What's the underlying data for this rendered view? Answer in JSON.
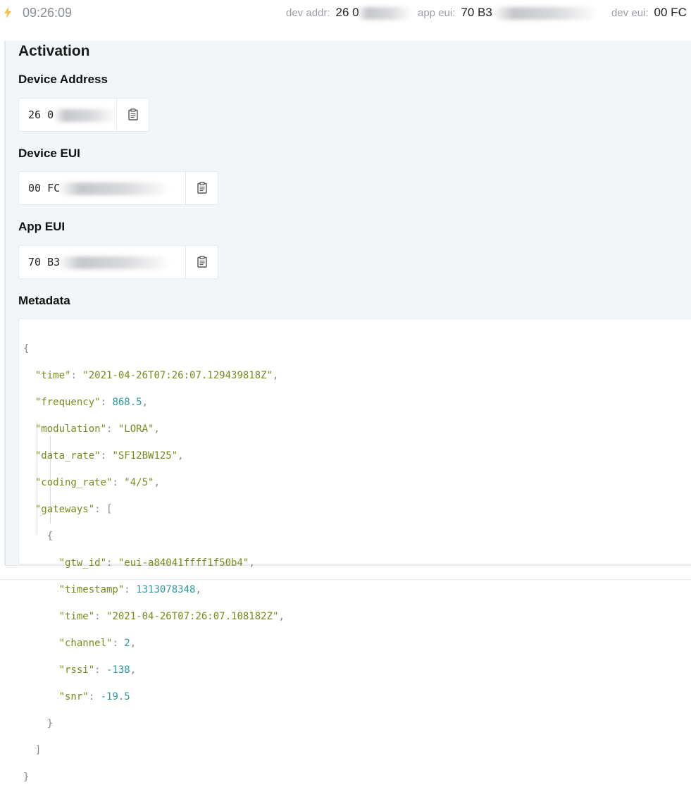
{
  "header": {
    "time": "09:26:09",
    "dev_addr_label": "dev addr:",
    "dev_addr_value": "26 0",
    "app_eui_label": "app eui:",
    "app_eui_value": "70 B3",
    "dev_eui_label": "dev eui:",
    "dev_eui_value": "00 FC"
  },
  "activation": {
    "title": "Activation",
    "device_address_label": "Device Address",
    "device_address_value": "26 0",
    "device_eui_label": "Device EUI",
    "device_eui_value": "00 FC",
    "app_eui_label": "App EUI",
    "app_eui_value": "70 B3"
  },
  "metadata": {
    "label": "Metadata",
    "json": {
      "time_key": "\"time\"",
      "time_val": "\"2021-04-26T07:26:07.129439818Z\"",
      "frequency_key": "\"frequency\"",
      "frequency_val": "868.5",
      "modulation_key": "\"modulation\"",
      "modulation_val": "\"LORA\"",
      "data_rate_key": "\"data_rate\"",
      "data_rate_val": "\"SF12BW125\"",
      "coding_rate_key": "\"coding_rate\"",
      "coding_rate_val": "\"4/5\"",
      "gateways_key": "\"gateways\"",
      "gtw_id_key": "\"gtw_id\"",
      "gtw_id_val": "\"eui-a84041ffff1f50b4\"",
      "timestamp_key": "\"timestamp\"",
      "timestamp_val": "1313078348",
      "gw_time_key": "\"time\"",
      "gw_time_val": "\"2021-04-26T07:26:07.108182Z\"",
      "channel_key": "\"channel\"",
      "channel_val": "2",
      "rssi_key": "\"rssi\"",
      "rssi_val": "-138",
      "snr_key": "\"snr\"",
      "snr_val": "-19.5"
    }
  },
  "icons": {
    "status": "lightning-icon",
    "copy": "clipboard-icon"
  },
  "colors": {
    "panel_bg": "#f2f6f8",
    "json_key": "#7a8a1a",
    "json_number": "#2d9aa0",
    "bolt": "#f3c24a"
  }
}
